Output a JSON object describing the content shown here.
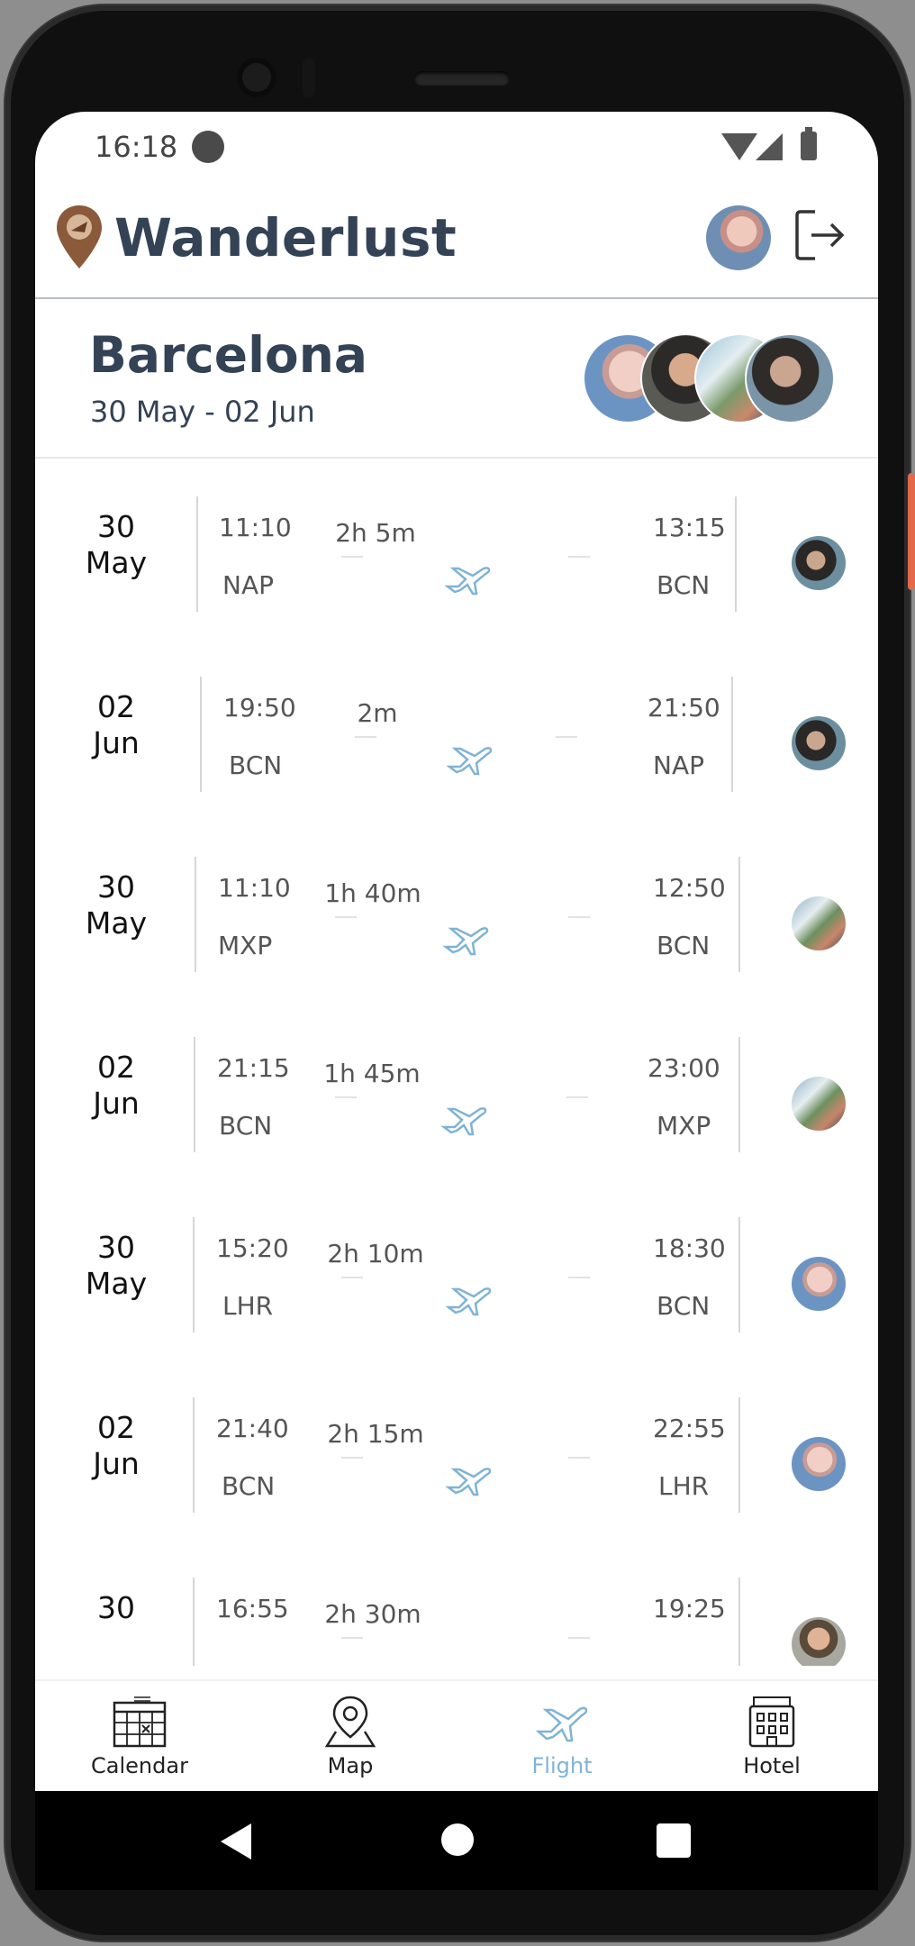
{
  "status_bar": {
    "time": "16:18"
  },
  "header": {
    "app_title": "Wanderlust"
  },
  "trip": {
    "city": "Barcelona",
    "dates": "30 May - 02 Jun"
  },
  "flights": [
    {
      "date_day": "30",
      "date_month": "May",
      "dep_time": "11:10",
      "dep_code": "NAP",
      "duration": "2h 5m",
      "arr_time": "13:15",
      "arr_code": "BCN"
    },
    {
      "date_day": "02",
      "date_month": "Jun",
      "dep_time": "19:50",
      "dep_code": "BCN",
      "duration": "2m",
      "arr_time": "21:50",
      "arr_code": "NAP"
    },
    {
      "date_day": "30",
      "date_month": "May",
      "dep_time": "11:10",
      "dep_code": "MXP",
      "duration": "1h 40m",
      "arr_time": "12:50",
      "arr_code": "BCN"
    },
    {
      "date_day": "02",
      "date_month": "Jun",
      "dep_time": "21:15",
      "dep_code": "BCN",
      "duration": "1h 45m",
      "arr_time": "23:00",
      "arr_code": "MXP"
    },
    {
      "date_day": "30",
      "date_month": "May",
      "dep_time": "15:20",
      "dep_code": "LHR",
      "duration": "2h 10m",
      "arr_time": "18:30",
      "arr_code": "BCN"
    },
    {
      "date_day": "02",
      "date_month": "Jun",
      "dep_time": "21:40",
      "dep_code": "BCN",
      "duration": "2h 15m",
      "arr_time": "22:55",
      "arr_code": "LHR"
    },
    {
      "date_day": "30",
      "date_month": "",
      "dep_time": "16:55",
      "dep_code": "",
      "duration": "2h 30m",
      "arr_time": "19:25",
      "arr_code": ""
    }
  ],
  "tabs": [
    {
      "label": "Calendar",
      "icon": "calendar-icon",
      "active": false
    },
    {
      "label": "Map",
      "icon": "map-pin-icon",
      "active": false
    },
    {
      "label": "Flight",
      "icon": "plane-icon",
      "active": true
    },
    {
      "label": "Hotel",
      "icon": "hotel-icon",
      "active": false
    }
  ],
  "colors": {
    "accent": "#7fb3d5",
    "title": "#344256"
  }
}
